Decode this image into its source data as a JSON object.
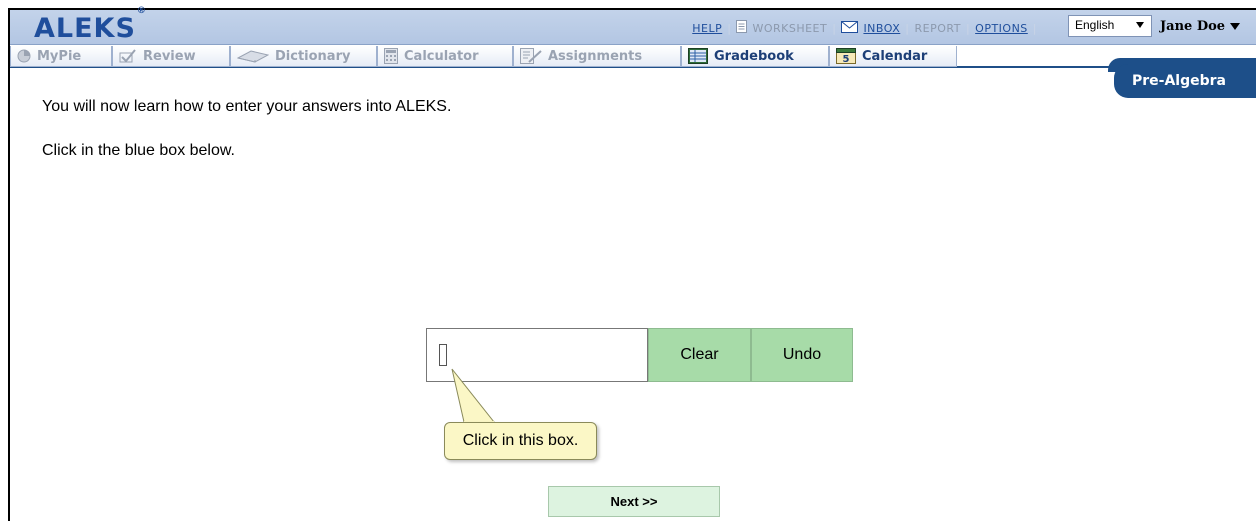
{
  "header": {
    "logo": "ALEKS",
    "logo_mark": "®",
    "links": {
      "help": "HELP",
      "worksheet": "WORKSHEET",
      "inbox": "INBOX",
      "report": "REPORT",
      "options": "OPTIONS"
    },
    "language": "English",
    "user_name": "Jane Doe"
  },
  "tabs": [
    {
      "label": "MyPie",
      "icon": "pie-icon",
      "state": "disabled"
    },
    {
      "label": "Review",
      "icon": "checkmark-icon",
      "state": "disabled"
    },
    {
      "label": "Dictionary",
      "icon": "book-icon",
      "state": "disabled"
    },
    {
      "label": "Calculator",
      "icon": "calculator-icon",
      "state": "disabled"
    },
    {
      "label": "Assignments",
      "icon": "assignment-icon",
      "state": "disabled"
    },
    {
      "label": "Gradebook",
      "icon": "gradebook-icon",
      "state": "active"
    },
    {
      "label": "Calendar",
      "icon": "calendar-icon",
      "state": "active"
    }
  ],
  "subject": "Pre-Algebra",
  "content": {
    "instruction_1": "You will now learn how to enter your answers into ALEKS.",
    "instruction_2": "Click in the blue box below.",
    "clear_label": "Clear",
    "undo_label": "Undo",
    "tooltip": "Click in this box.",
    "next_label": "Next >>"
  },
  "colors": {
    "brand_blue": "#1f4e9c",
    "header_bg": "#b9cbe6",
    "subject_tab": "#1d4f89",
    "button_green": "#a7dba8",
    "tooltip_bg": "#fbf7c6"
  }
}
